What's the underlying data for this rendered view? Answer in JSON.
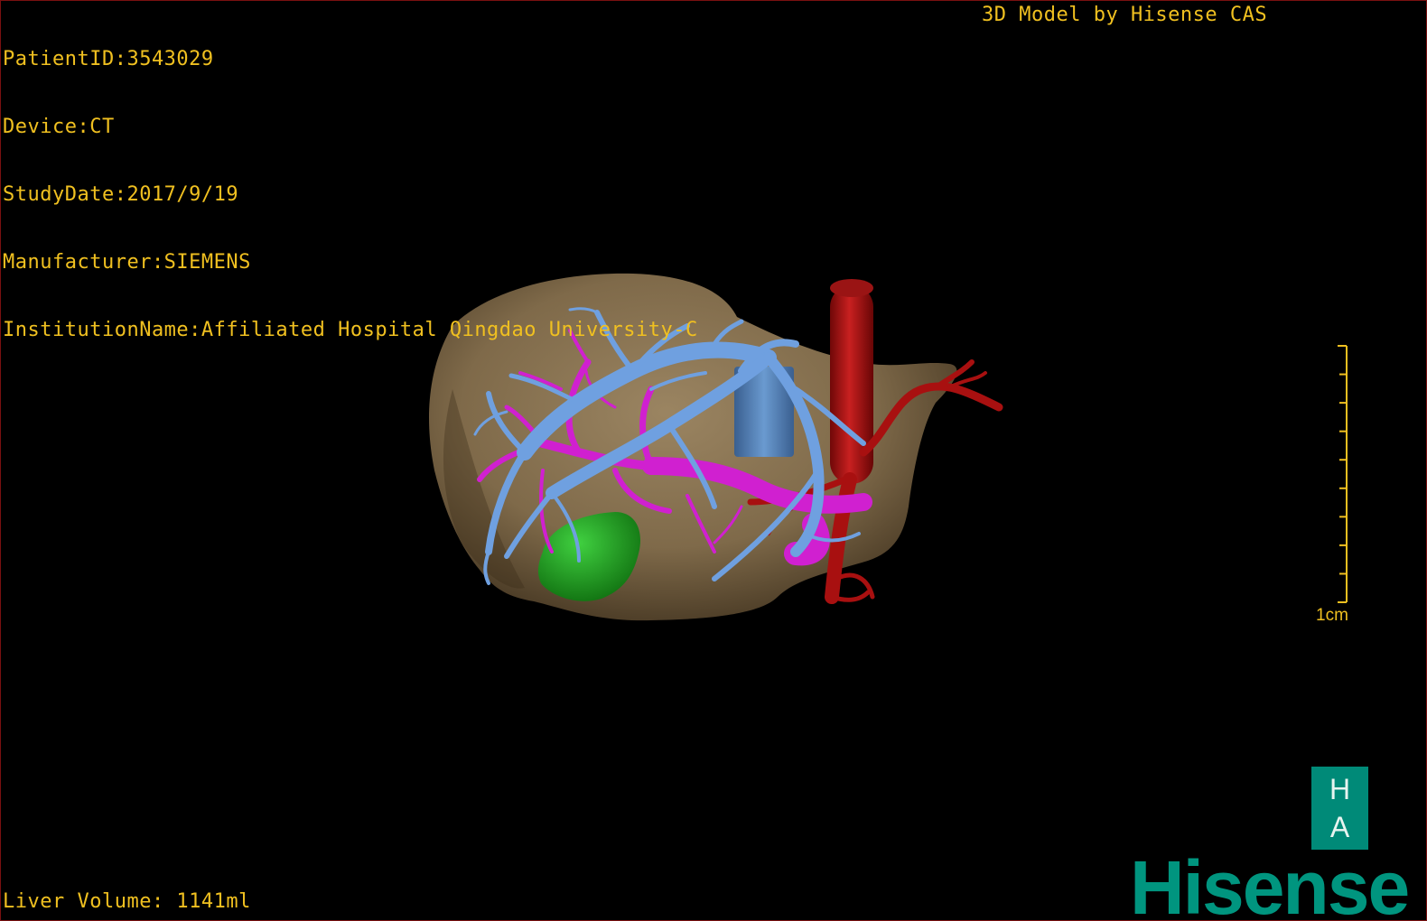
{
  "patient_info": {
    "patient_id": "PatientID:3543029",
    "device": "Device:CT",
    "study_date": "StudyDate:2017/9/19",
    "manufacturer": "Manufacturer:SIEMENS",
    "institution": "InstitutionName:Affiliated Hospital Qingdao University-C"
  },
  "model_label": "3D Model by Hisense CAS",
  "liver_volume": "Liver Volume: 1141ml",
  "scale": {
    "label": "1cm",
    "ticks": 9
  },
  "logo": {
    "letter_top": "H",
    "letter_bottom": "A",
    "word": "Hisense"
  },
  "colors": {
    "overlay_text": "#f0c020",
    "liver": "#8a7350",
    "hepatic_vein": "#6fa0e0",
    "portal_vein": "#d020d0",
    "artery": "#b01010",
    "gallbladder": "#20a020",
    "ivc": "#5080b8",
    "brand": "#00957f"
  }
}
